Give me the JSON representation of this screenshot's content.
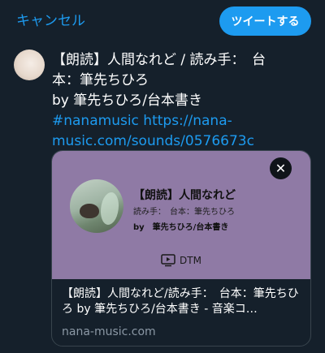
{
  "header": {
    "cancel_label": "キャンセル",
    "tweet_label": "ツイートする"
  },
  "tweet": {
    "lines": [
      "【朗読】人間なれど / 読み手：　台",
      "本：筆先ちひろ",
      "by 筆先ちひろ/台本書き"
    ],
    "hashtag": "#nanamusic",
    "url_part1": "https://nana-",
    "url_part2": "music.com/sounds/0576673c"
  },
  "card": {
    "close_icon": "close-icon",
    "media": {
      "background": "#8f7aa5",
      "title": "【朗読】人間なれど",
      "subtitle": "読み手：　台本：筆先ちひろ",
      "by_line": "by　筆先ちひろ/台本書き",
      "tag": "DTM"
    },
    "description": "【朗読】人間なれど/読み手：　台本：筆先ちひろ by 筆先ちひろ/台本書き - 音楽コ…",
    "domain": "nana-music.com"
  },
  "colors": {
    "background": "#15202b",
    "accent": "#1d9bf0"
  }
}
